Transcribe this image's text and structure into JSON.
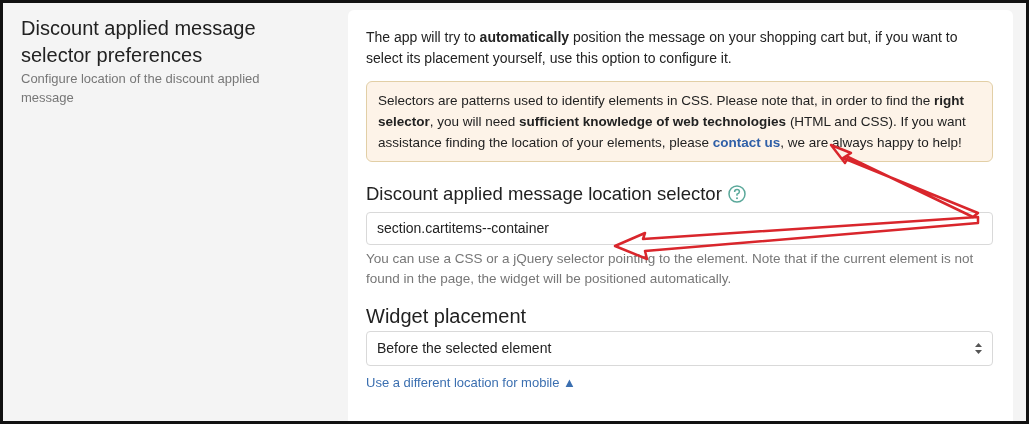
{
  "section": {
    "title": "Discount applied message selector preferences",
    "description": "Configure location of the discount applied message"
  },
  "intro": "The app will try to **automatically** position the message on your shopping cart but, if you want to select its placement yourself, use this option to configure it.",
  "notice": {
    "text_before": "Selectors are patterns used to identify elements in CSS. Please note that, in order to find the **right selector**, you will need **sufficient knowledge of web technologies** (HTML and CSS). If you want assistance finding the location of your elements, please",
    "link": "contact us",
    "text_after": ", we are always happy to help!"
  },
  "selector_field": {
    "label": "Discount applied message location selector",
    "help_icon": true,
    "value": "section.cartitems--container",
    "hint": "You can use a CSS or a jQuery selector pointing to the element. Note that if the current element is not found in the page, the widget will be positioned automatically."
  },
  "placement_field": {
    "label": "Widget placement",
    "value": "Before the selected element"
  },
  "mobile_link": {
    "text": "Use a different location for mobile",
    "icon": "▲"
  },
  "annotations": [
    {
      "kind": "arrow"
    },
    {
      "kind": "arrow"
    }
  ]
}
